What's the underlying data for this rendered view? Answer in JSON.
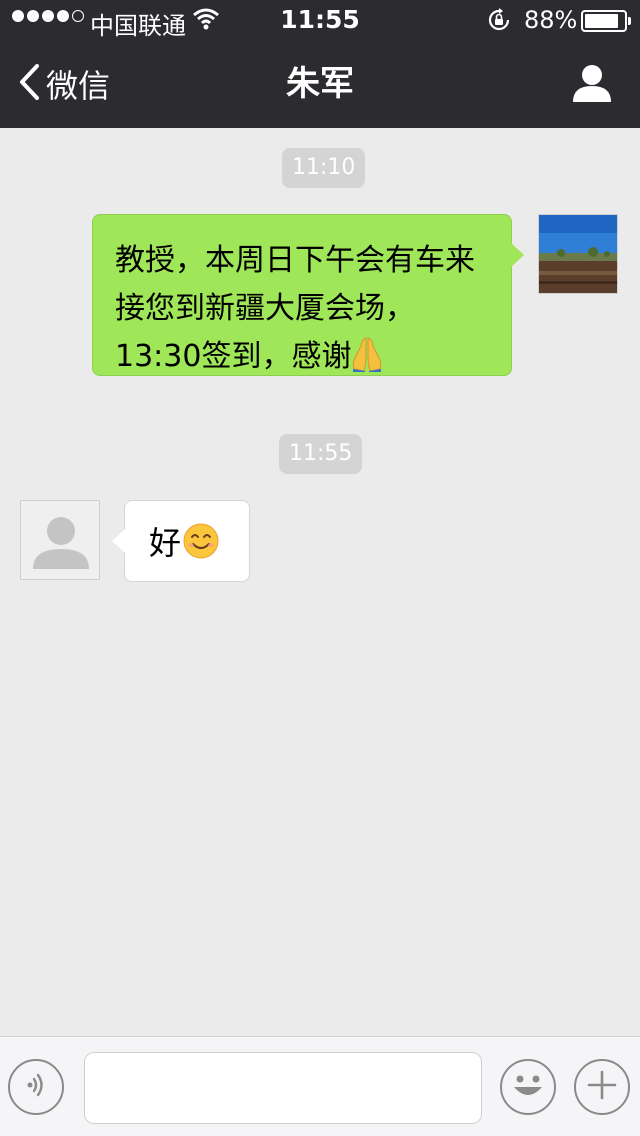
{
  "status_bar": {
    "carrier": "中国联通",
    "time": "11:55",
    "battery_percent": "88%",
    "battery_level": 0.88,
    "signal_bars_filled": 4,
    "signal_bars_total": 5
  },
  "nav": {
    "back_label": "微信",
    "title": "朱军",
    "back_icon": "chevron-left-icon",
    "profile_icon": "person-icon"
  },
  "messages": {
    "timestamp_1": "11:10",
    "sent_message": "教授，本周日下午会有车来接您到新疆大厦会场，13:30签到，感谢",
    "sent_emoji": "folded-hands",
    "timestamp_2": "11:55",
    "received_message": "好",
    "received_emoji": "smiling-face"
  },
  "input_bar": {
    "input_value": "",
    "voice_icon": "voice-icon",
    "emoji_icon": "emoji-icon",
    "plus_icon": "plus-icon"
  },
  "colors": {
    "header_bg": "#2c2c30",
    "chat_bg": "#ebebeb",
    "sent_bubble": "#9fe658",
    "received_bubble": "#ffffff",
    "timestamp_bg": "#d4d4d4"
  }
}
